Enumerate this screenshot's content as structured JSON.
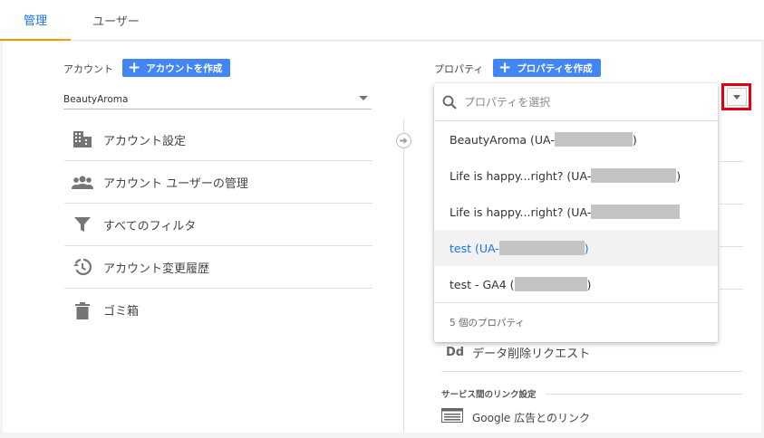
{
  "tabs": {
    "admin": "管理",
    "user": "ユーザー"
  },
  "account": {
    "heading": "アカウント",
    "create_label": "アカウントを作成",
    "selected": "BeautyAroma",
    "menu": [
      {
        "label": "アカウント設定",
        "icon": "building-icon"
      },
      {
        "label": "アカウント ユーザーの管理",
        "icon": "users-icon"
      },
      {
        "label": "すべてのフィルタ",
        "icon": "filter-icon"
      },
      {
        "label": "アカウント変更履歴",
        "icon": "history-icon"
      },
      {
        "label": "ゴミ箱",
        "icon": "trash-icon"
      }
    ]
  },
  "property": {
    "heading": "プロパティ",
    "create_label": "プロパティを作成",
    "data_delete": {
      "icon_text": "Dd",
      "label": "データ削除リクエスト"
    },
    "section_title": "サービス間のリンク設定",
    "google_ads_link": "Google 広告とのリンク"
  },
  "dropdown": {
    "search_placeholder": "プロパティを選択",
    "options": [
      {
        "prefix": "BeautyAroma (UA-",
        "suffix": ")"
      },
      {
        "prefix": "Life is happy...right? (UA-",
        "suffix": ")"
      },
      {
        "prefix": "Life is happy...right? (UA-",
        "suffix": ""
      },
      {
        "prefix": "test (UA-",
        "suffix": ")"
      },
      {
        "prefix": "test - GA4 (",
        "suffix": ")"
      }
    ],
    "selected_index": 3,
    "footer": "5 個のプロパティ"
  },
  "colors": {
    "accent": "#1a73e8",
    "tab_underline": "#f29900",
    "button": "#4285f4",
    "highlight_box": "#e00012"
  }
}
